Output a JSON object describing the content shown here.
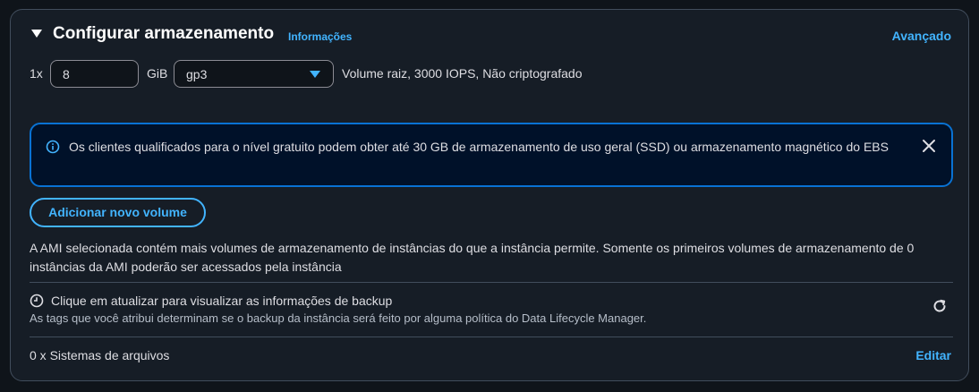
{
  "section": {
    "title": "Configurar armazenamento",
    "info_link": "Informações",
    "advanced_link": "Avançado"
  },
  "volume": {
    "count_label": "1x",
    "size_value": "8",
    "size_unit": "GiB",
    "type_value": "gp3",
    "summary": "Volume raiz,  3000 IOPS,  Não criptografado"
  },
  "alert": {
    "text": "Os clientes qualificados para o nível gratuito podem obter até 30 GB de armazenamento de uso geral (SSD) ou armazenamento magnético do EBS",
    "icon": "info-icon",
    "close_icon": "close-icon"
  },
  "add_volume_button": "Adicionar novo volume",
  "ami_note": "A AMI selecionada contém mais volumes de armazenamento de instâncias do que a instância permite. Somente os primeiros volumes de armazenamento de 0 instâncias da AMI poderão ser acessados pela instância",
  "backup": {
    "title": "Clique em atualizar para visualizar as informações de backup",
    "description": "As tags que você atribui determinam se o backup da instância será feito por alguma política do Data Lifecycle Manager.",
    "icon": "clock-icon",
    "refresh_icon": "refresh-icon"
  },
  "file_systems": {
    "label": "0 x Sistemas de arquivos",
    "edit_link": "Editar"
  },
  "colors": {
    "background": "#0f141a",
    "panel": "#161d26",
    "accent": "#42b4ff",
    "alert_border": "#0972d3",
    "alert_bg": "#001129"
  }
}
